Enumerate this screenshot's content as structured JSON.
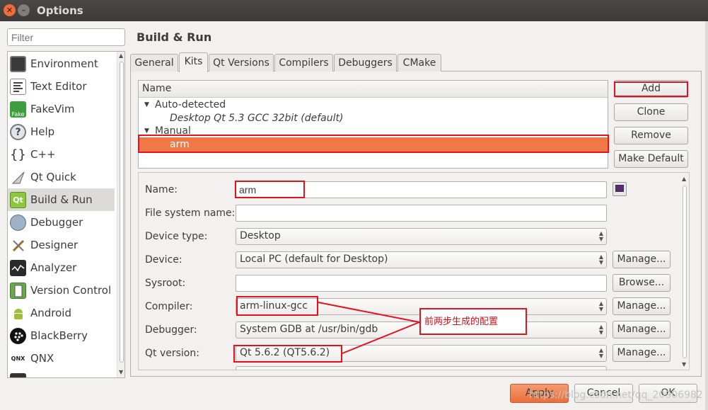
{
  "window": {
    "title": "Options"
  },
  "sidebar": {
    "filter_placeholder": "Filter",
    "items": [
      {
        "label": "Environment",
        "icon": "monitor-icon"
      },
      {
        "label": "Text Editor",
        "icon": "text-editor-icon"
      },
      {
        "label": "FakeVim",
        "icon": "fakevim-icon"
      },
      {
        "label": "Help",
        "icon": "help-icon"
      },
      {
        "label": "C++",
        "icon": "cpp-braces-icon"
      },
      {
        "label": "Qt Quick",
        "icon": "qt-quick-icon"
      },
      {
        "label": "Build & Run",
        "icon": "qt-logo-icon"
      },
      {
        "label": "Debugger",
        "icon": "debugger-bug-icon"
      },
      {
        "label": "Designer",
        "icon": "designer-tools-icon"
      },
      {
        "label": "Analyzer",
        "icon": "analyzer-icon"
      },
      {
        "label": "Version Control",
        "icon": "version-control-icon"
      },
      {
        "label": "Android",
        "icon": "android-icon"
      },
      {
        "label": "BlackBerry",
        "icon": "blackberry-icon"
      },
      {
        "label": "QNX",
        "icon": "qnx-icon"
      }
    ],
    "selected": "Build & Run"
  },
  "page": {
    "heading": "Build & Run"
  },
  "tabs": [
    {
      "label": "General"
    },
    {
      "label": "Kits"
    },
    {
      "label": "Qt Versions"
    },
    {
      "label": "Compilers"
    },
    {
      "label": "Debuggers"
    },
    {
      "label": "CMake"
    }
  ],
  "active_tab": "Kits",
  "kits": {
    "column_header": "Name",
    "auto_group": "Auto-detected",
    "auto_kit": "Desktop Qt 5.3 GCC 32bit (default)",
    "manual_group": "Manual",
    "manual_kit": "arm"
  },
  "kit_buttons": {
    "add": "Add",
    "clone": "Clone",
    "remove": "Remove",
    "make_default": "Make Default"
  },
  "form": {
    "name_label": "Name:",
    "name_value": "arm",
    "filesystem_label": "File system name:",
    "filesystem_value": "",
    "device_type_label": "Device type:",
    "device_type_value": "Desktop",
    "device_label": "Device:",
    "device_value": "Local PC (default for Desktop)",
    "sysroot_label": "Sysroot:",
    "sysroot_value": "",
    "compiler_label": "Compiler:",
    "compiler_value": "arm-linux-gcc",
    "debugger_label": "Debugger:",
    "debugger_value": "System GDB at /usr/bin/gdb",
    "qt_version_label": "Qt version:",
    "qt_version_value": "Qt 5.6.2 (QT5.6.2)",
    "manage_label": "Manage...",
    "browse_label": "Browse..."
  },
  "annotation": {
    "text": "前两步生成的配置"
  },
  "footer": {
    "apply": "Apply",
    "cancel": "Cancel",
    "ok": "OK",
    "watermark": "https://blog.csdn.net/qq_20906982"
  },
  "colors": {
    "selection": "#f07746",
    "annotation_red": "#e0131f",
    "titlebar": "#3f3e3a"
  }
}
